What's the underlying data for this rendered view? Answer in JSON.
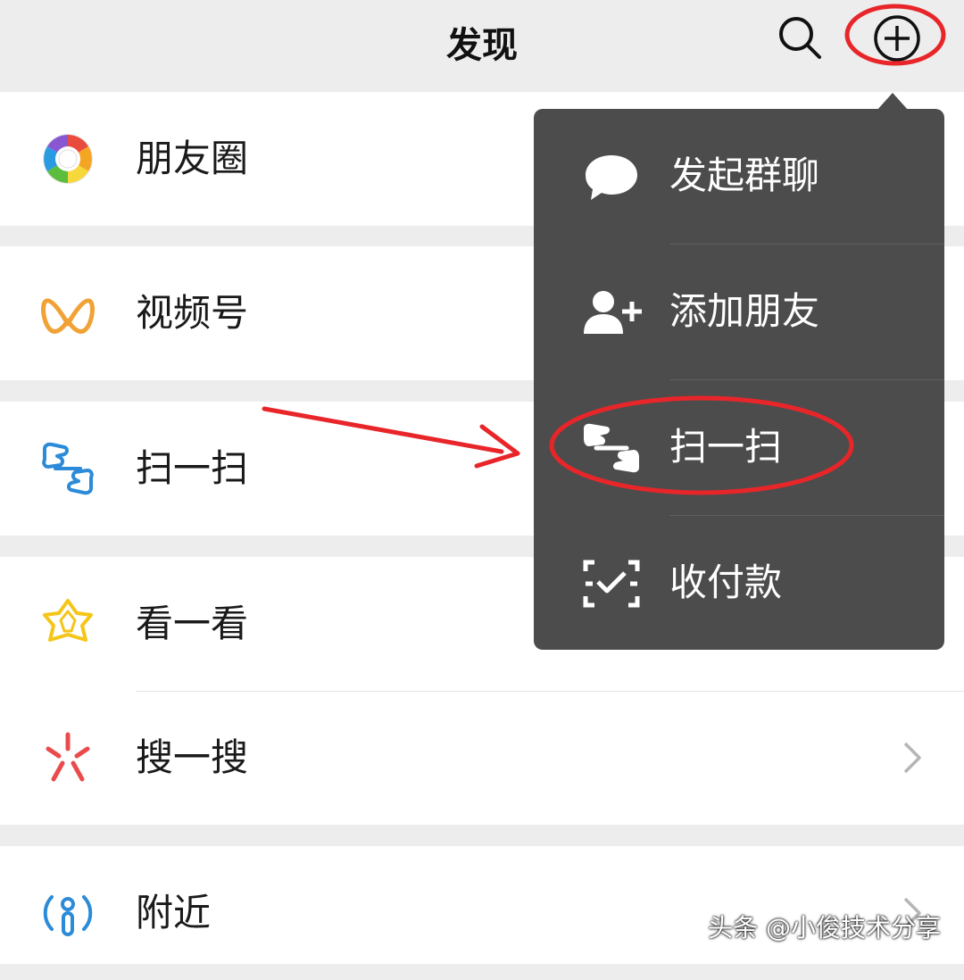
{
  "header": {
    "title": "发现",
    "search_icon": "search-icon",
    "add_icon": "plus-circle-icon"
  },
  "list": {
    "items": [
      {
        "label": "朋友圈",
        "icon": "moments-aperture-icon"
      },
      {
        "label": "视频号",
        "icon": "channels-icon"
      },
      {
        "label": "扫一扫",
        "icon": "scan-icon"
      },
      {
        "label": "看一看",
        "icon": "top-stories-icon",
        "badge": "red-dot"
      },
      {
        "label": "搜一搜",
        "icon": "search-sparkle-icon"
      },
      {
        "label": "附近",
        "icon": "nearby-icon"
      }
    ]
  },
  "popup_menu": {
    "items": [
      {
        "label": "发起群聊",
        "icon": "chat-bubble-icon"
      },
      {
        "label": "添加朋友",
        "icon": "add-friend-icon"
      },
      {
        "label": "扫一扫",
        "icon": "scan-icon"
      },
      {
        "label": "收付款",
        "icon": "payment-check-icon"
      }
    ]
  },
  "watermark": "头条 @小俊技术分享",
  "colors": {
    "background": "#ededed",
    "menu_bg": "#4c4c4c",
    "annotation_red": "#e8262a",
    "badge_red": "#f0454a"
  }
}
